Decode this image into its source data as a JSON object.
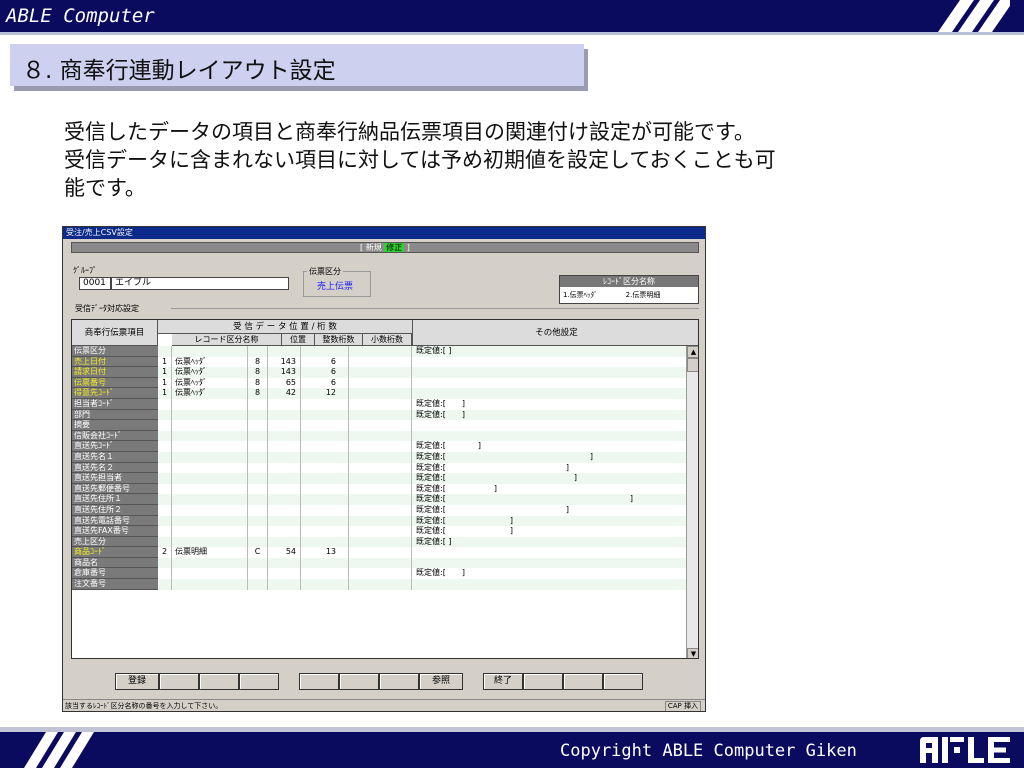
{
  "slide": {
    "brand": "ABLE Computer",
    "title": "８. 商奉行連動レイアウト設定",
    "description_lines": [
      "受信したデータの項目と商奉行納品伝票項目の関連付け設定が可能です。",
      "受信データに含まれない項目に対しては予め初期値を設定しておくことも可",
      "能です。"
    ],
    "copyright": "Copyright ABLE Computer Giken",
    "colors": {
      "navy": "#0a0a5e",
      "title_bg": "#cdd0ee"
    }
  },
  "window": {
    "title": "受注/売上CSV設定",
    "mode_open": "[ ",
    "mode_new": "新規",
    "mode_edit": "修正",
    "mode_close": " ]",
    "group_label": "ｸﾞﾙｰﾌﾟ",
    "group_code": "0001",
    "group_name": "エイブル",
    "slip_kubun_label": "伝票区分",
    "slip_kubun_value": "売上伝票",
    "record_kubun_header": "ﾚｺｰﾄﾞ区分名称",
    "record_kubun_value": "1.伝票ﾍｯﾀﾞ　　　　2.伝票明細",
    "section_label": "受信ﾃﾞｰﾀ対応設定",
    "headers": {
      "item": "商奉行伝票項目",
      "main": "受 信 デ ー タ 位 置 / 桁 数",
      "record_name": "レコード区分名称",
      "position": "位置",
      "int_digits": "整数桁数",
      "dec_digits": "小数桁数",
      "other": "その他設定"
    },
    "rows": [
      {
        "item": "伝票区分",
        "hl": false,
        "no": "",
        "name": "",
        "type": "",
        "pos": "",
        "int": "",
        "dec": "",
        "other": "既定値:[ ]"
      },
      {
        "item": "売上日付",
        "hl": true,
        "no": "1",
        "name": "伝票ﾍｯﾀﾞ",
        "type": "8",
        "pos": "143",
        "int": "6",
        "dec": "",
        "other": ""
      },
      {
        "item": "請求日付",
        "hl": true,
        "no": "1",
        "name": "伝票ﾍｯﾀﾞ",
        "type": "8",
        "pos": "143",
        "int": "6",
        "dec": "",
        "other": ""
      },
      {
        "item": "伝票番号",
        "hl": true,
        "no": "1",
        "name": "伝票ﾍｯﾀﾞ",
        "type": "8",
        "pos": "65",
        "int": "6",
        "dec": "",
        "other": ""
      },
      {
        "item": "得意先ｺｰﾄﾞ",
        "hl": true,
        "no": "1",
        "name": "伝票ﾍｯﾀﾞ",
        "type": "8",
        "pos": "42",
        "int": "12",
        "dec": "",
        "other": ""
      },
      {
        "item": "担当者ｺｰﾄﾞ",
        "hl": false,
        "no": "",
        "name": "",
        "type": "",
        "pos": "",
        "int": "",
        "dec": "",
        "other": "既定値:[　　]"
      },
      {
        "item": "部門",
        "hl": false,
        "no": "",
        "name": "",
        "type": "",
        "pos": "",
        "int": "",
        "dec": "",
        "other": "既定値:[　　]"
      },
      {
        "item": "摘要",
        "hl": false,
        "no": "",
        "name": "",
        "type": "",
        "pos": "",
        "int": "",
        "dec": "",
        "other": ""
      },
      {
        "item": "信販会社ｺｰﾄﾞ",
        "hl": false,
        "no": "",
        "name": "",
        "type": "",
        "pos": "",
        "int": "",
        "dec": "",
        "other": ""
      },
      {
        "item": "直送先ｺｰﾄﾞ",
        "hl": false,
        "no": "",
        "name": "",
        "type": "",
        "pos": "",
        "int": "",
        "dec": "",
        "other": "既定値:[　　　　]"
      },
      {
        "item": "直送先名１",
        "hl": false,
        "no": "",
        "name": "",
        "type": "",
        "pos": "",
        "int": "",
        "dec": "",
        "other": "既定値:[　　　　　　　　　　　　　　　　　　]"
      },
      {
        "item": "直送先名２",
        "hl": false,
        "no": "",
        "name": "",
        "type": "",
        "pos": "",
        "int": "",
        "dec": "",
        "other": "既定値:[　　　　　　　　　　　　　　　]"
      },
      {
        "item": "直送先担当者",
        "hl": false,
        "no": "",
        "name": "",
        "type": "",
        "pos": "",
        "int": "",
        "dec": "",
        "other": "既定値:[　　　　　　　　　　　　　　　　]"
      },
      {
        "item": "直送先郵便番号",
        "hl": false,
        "no": "",
        "name": "",
        "type": "",
        "pos": "",
        "int": "",
        "dec": "",
        "other": "既定値:[　　　　　　]"
      },
      {
        "item": "直送先住所１",
        "hl": false,
        "no": "",
        "name": "",
        "type": "",
        "pos": "",
        "int": "",
        "dec": "",
        "other": "既定値:[　　　　　　　　　　　　　　　　　　　　　　　]"
      },
      {
        "item": "直送先住所２",
        "hl": false,
        "no": "",
        "name": "",
        "type": "",
        "pos": "",
        "int": "",
        "dec": "",
        "other": "既定値:[　　　　　　　　　　　　　　　]"
      },
      {
        "item": "直送先電話番号",
        "hl": false,
        "no": "",
        "name": "",
        "type": "",
        "pos": "",
        "int": "",
        "dec": "",
        "other": "既定値:[　　　　　　　　]"
      },
      {
        "item": "直送先FAX番号",
        "hl": false,
        "no": "",
        "name": "",
        "type": "",
        "pos": "",
        "int": "",
        "dec": "",
        "other": "既定値:[　　　　　　　　]"
      },
      {
        "item": "売上区分",
        "hl": false,
        "no": "",
        "name": "",
        "type": "",
        "pos": "",
        "int": "",
        "dec": "",
        "other": "既定値:[ ]"
      },
      {
        "item": "商品ｺｰﾄﾞ",
        "hl": true,
        "no": "2",
        "name": "伝票明細",
        "type": "C",
        "pos": "54",
        "int": "13",
        "dec": "",
        "other": ""
      },
      {
        "item": "商品名",
        "hl": false,
        "no": "",
        "name": "",
        "type": "",
        "pos": "",
        "int": "",
        "dec": "",
        "other": ""
      },
      {
        "item": "倉庫番号",
        "hl": false,
        "no": "",
        "name": "",
        "type": "",
        "pos": "",
        "int": "",
        "dec": "",
        "other": "既定値:[　　]"
      },
      {
        "item": "注文番号",
        "hl": false,
        "no": "",
        "name": "",
        "type": "",
        "pos": "",
        "int": "",
        "dec": "",
        "other": ""
      }
    ],
    "fkeys": {
      "register": "登録",
      "reference": "参照",
      "end": "終了"
    },
    "status_message": "該当するﾚｺｰﾄﾞ区分名称の番号を入力して下さい。",
    "status_right": "CAP 挿入"
  }
}
